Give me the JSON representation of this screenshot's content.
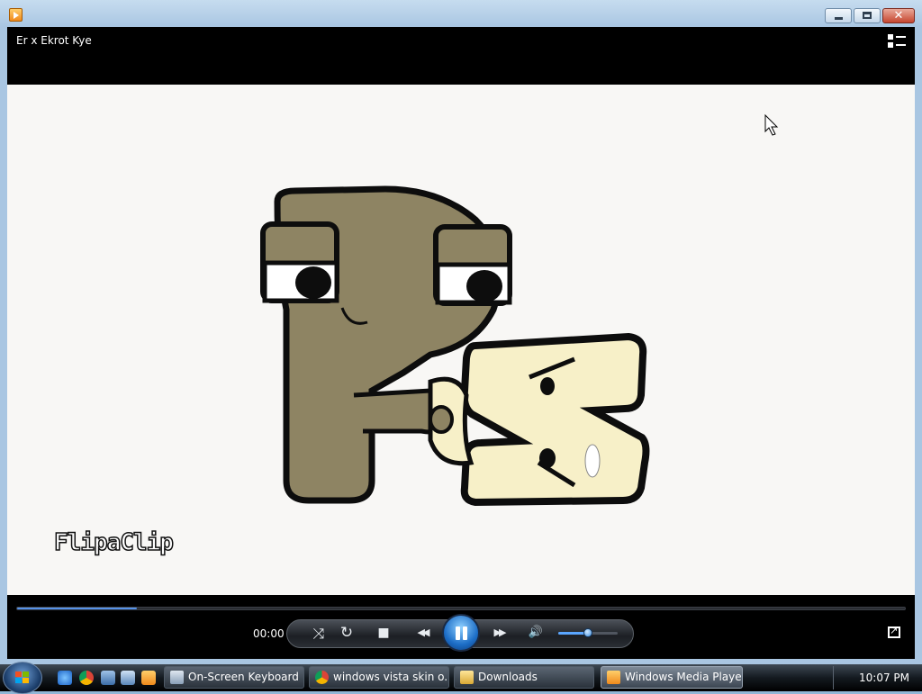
{
  "window": {
    "app_icon": "wmp-icon",
    "buttons": {
      "minimize": "minimize-icon",
      "maximize": "maximize-icon",
      "close": "✕"
    }
  },
  "player": {
    "media_title": "Er x Ekrot Kye",
    "list_toggle_icon": "switch-to-library-icon",
    "video": {
      "watermark": "FlipaClip",
      "cursor_icon": "mouse-cursor-icon"
    },
    "seek_progress_fraction": 0.135,
    "time": "00:00",
    "controls": {
      "shuffle": "⤨",
      "repeat": "↻",
      "stop": "■",
      "previous": "◀◀",
      "play_pause_state": "pause",
      "next": "▶▶",
      "mute": "🔊"
    },
    "volume_fraction": 0.5,
    "switch_view_icon": "switch-to-now-playing-icon"
  },
  "taskbar": {
    "quick_launch": [
      "ie-icon",
      "chrome-icon",
      "show-desktop-icon",
      "switch-windows-icon",
      "wmp-icon"
    ],
    "buttons": [
      {
        "label": "On-Screen Keyboard",
        "active": false
      },
      {
        "label": "windows vista skin o...",
        "active": false
      },
      {
        "label": "Downloads",
        "active": false
      },
      {
        "label": "Windows Media Player",
        "active": true
      }
    ],
    "clock": "10:07 PM"
  },
  "colors": {
    "accent": "#2c6fd1",
    "video_bg": "#f8f7f5"
  }
}
